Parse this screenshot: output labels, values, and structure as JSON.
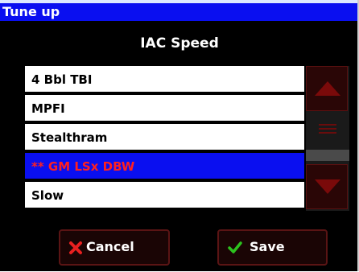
{
  "window": {
    "title": "Tune up"
  },
  "heading": "IAC Speed",
  "list": {
    "items": [
      {
        "label": "4 Bbl TBI",
        "selected": false
      },
      {
        "label": "MPFI",
        "selected": false
      },
      {
        "label": "Stealthram",
        "selected": false
      },
      {
        "label": "** GM LSx DBW",
        "selected": true
      },
      {
        "label": "Slow",
        "selected": false
      }
    ]
  },
  "scrollbar": {
    "up_icon": "triangle-up-icon",
    "grip_icon": "grip-lines-icon",
    "down_icon": "triangle-down-icon"
  },
  "buttons": {
    "cancel": {
      "label": "Cancel",
      "icon": "x-icon"
    },
    "save": {
      "label": "Save",
      "icon": "check-icon"
    }
  },
  "colors": {
    "titlebar": "#0a0ff0",
    "selection": "#0a0ff0",
    "selected_text": "#ff2020",
    "scroll_arrow": "#7a0a0a"
  }
}
